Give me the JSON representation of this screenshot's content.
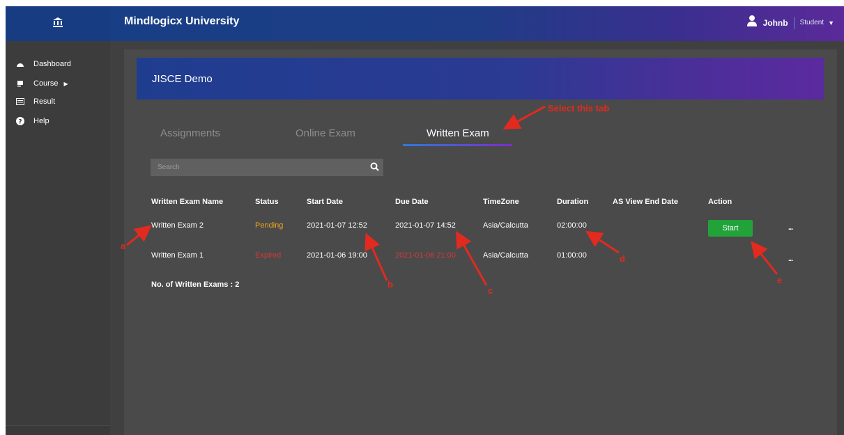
{
  "header": {
    "logo_icon": "institution-icon",
    "brand": "Mindlogicx University",
    "user_icon": "user-icon",
    "username": "Johnb",
    "role": "Student",
    "dropdown_icon": "caret-down-icon"
  },
  "sidebar": {
    "items": [
      {
        "label": "Dashboard",
        "icon": "dashboard-icon"
      },
      {
        "label": "Course",
        "icon": "book-icon"
      },
      {
        "label": "Result",
        "icon": "result-icon"
      },
      {
        "label": "Help",
        "icon": "help-icon"
      }
    ]
  },
  "course": {
    "title": "JISCE Demo"
  },
  "tabs": [
    {
      "label": "Assignments",
      "active": false
    },
    {
      "label": "Online Exam",
      "active": false
    },
    {
      "label": "Written Exam",
      "active": true
    }
  ],
  "search": {
    "placeholder": "Search"
  },
  "table": {
    "headers": [
      "Written Exam Name",
      "Status",
      "Start Date",
      "Due Date",
      "TimeZone",
      "Duration",
      "AS View End Date",
      "Action"
    ],
    "rows": [
      {
        "name": "Written Exam 2",
        "status": "Pending",
        "start": "2021-01-07 12:52",
        "due": "2021-01-07 14:52",
        "timezone": "Asia/Calcutta",
        "duration": "02:00:00",
        "view_end": "",
        "action": "Start",
        "more": "..."
      },
      {
        "name": "Written Exam 1",
        "status": "Expired",
        "start": "2021-01-06 19:00",
        "due": "2021-01-06 21:00",
        "timezone": "Asia/Calcutta",
        "duration": "01:00:00",
        "view_end": "",
        "action": "",
        "more": "..."
      }
    ],
    "count_label": "No. of Written Exams : 2"
  },
  "annotations": {
    "select_tab": "Select this tab",
    "a": "a",
    "b": "b",
    "c": "c",
    "d": "d",
    "e": "e"
  },
  "colors": {
    "pending": "#f0a71c",
    "expired": "#d43a3a",
    "start_button": "#21a33a",
    "annotation": "#e22a1f"
  }
}
